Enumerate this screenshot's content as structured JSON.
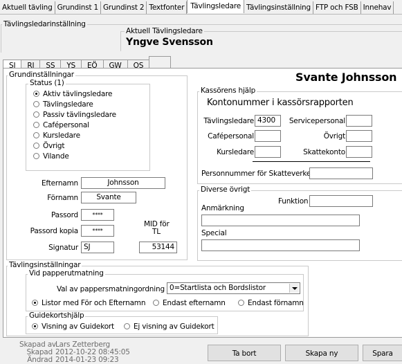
{
  "top_tabs": [
    "Aktuell tävling",
    "Grundinst 1",
    "Grundinst 2",
    "Textfonter",
    "Tävlingsledare",
    "Tävlingsinställning",
    "FTP och FSB",
    "Innehav"
  ],
  "active_top_tab": "Tävlingsledare",
  "settings_group_title": "Tävlingsledarinställning",
  "current_leader": {
    "caption": "Aktuell Tävlingsledare",
    "name": "Yngve Svensson"
  },
  "sub_tabs": [
    "SJ",
    "RJ",
    "SS",
    "YS",
    "EÖ",
    "GW",
    "OS",
    ""
  ],
  "active_sub_tab": "SJ",
  "display_name": "Svante Johnsson",
  "basics": {
    "title": "Grundinställningar",
    "status_title": "Status (1)",
    "status_options": [
      "Aktiv tävlingsledare",
      "Tävlingsledare",
      "Passiv tävlingsledare",
      "Cafépersonal",
      "Kursledare",
      "Övrigt",
      "Vilande"
    ],
    "status_selected": 0,
    "lastname_label": "Efternamn",
    "lastname": "Johnsson",
    "firstname_label": "Förnamn",
    "firstname": "Svante",
    "password_label": "Passord",
    "password": "****",
    "password_copy_label": "Passord kopia",
    "password_copy": "****",
    "mid_label_1": "MID för",
    "mid_label_2": "TL",
    "signature_label": "Signatur",
    "signature": "SJ",
    "mid": "53144"
  },
  "cashier": {
    "title": "Kassörens hjälp",
    "heading": "Kontonummer i kassörsrapporten",
    "leader_label": "Tävlingsledare",
    "leader_value": "4300",
    "service_label": "Servicepersonal",
    "service_value": "",
    "cafe_label": "Cafépersonal",
    "cafe_value": "",
    "other_label": "Övrigt",
    "other_value": "",
    "course_label": "Kursledare",
    "course_value": "",
    "tax_label": "Skattekonto",
    "tax_value": "",
    "personnr_label": "Personnummer för Skatteverket",
    "personnr_value": ""
  },
  "misc": {
    "title": "Diverse övrigt",
    "function_label": "Funktion",
    "function_value": "",
    "remark_label": "Anmärkning",
    "remark_value": "",
    "special_label": "Special",
    "special_value": ""
  },
  "competition": {
    "title": "Tävlingsinställningar",
    "paper_title": "Vid papperutmatning",
    "order_label": "Val av pappersmatningordning",
    "order_value": "0=Startlista och Bordslistor",
    "name_options": [
      "Listor med För och Efternamn",
      "Endast efternamn",
      "Endast förnamn"
    ],
    "name_selected": 0,
    "guide_title": "Guidekortshjälp",
    "guide_options": [
      "Visning av Guidekort",
      "Ej visning av Guidekort"
    ],
    "guide_selected": 0
  },
  "footer": {
    "created_by_label": "Skapad av",
    "created_by": "Lars Zetterberg",
    "created_label": "Skapad",
    "created": "2012-10-22 08:45:05",
    "changed_label": "Ändrad",
    "changed": "2014-01-23 09:23"
  },
  "buttons": {
    "delete": "Ta bort",
    "new": "Skapa ny",
    "save": "Spara"
  }
}
